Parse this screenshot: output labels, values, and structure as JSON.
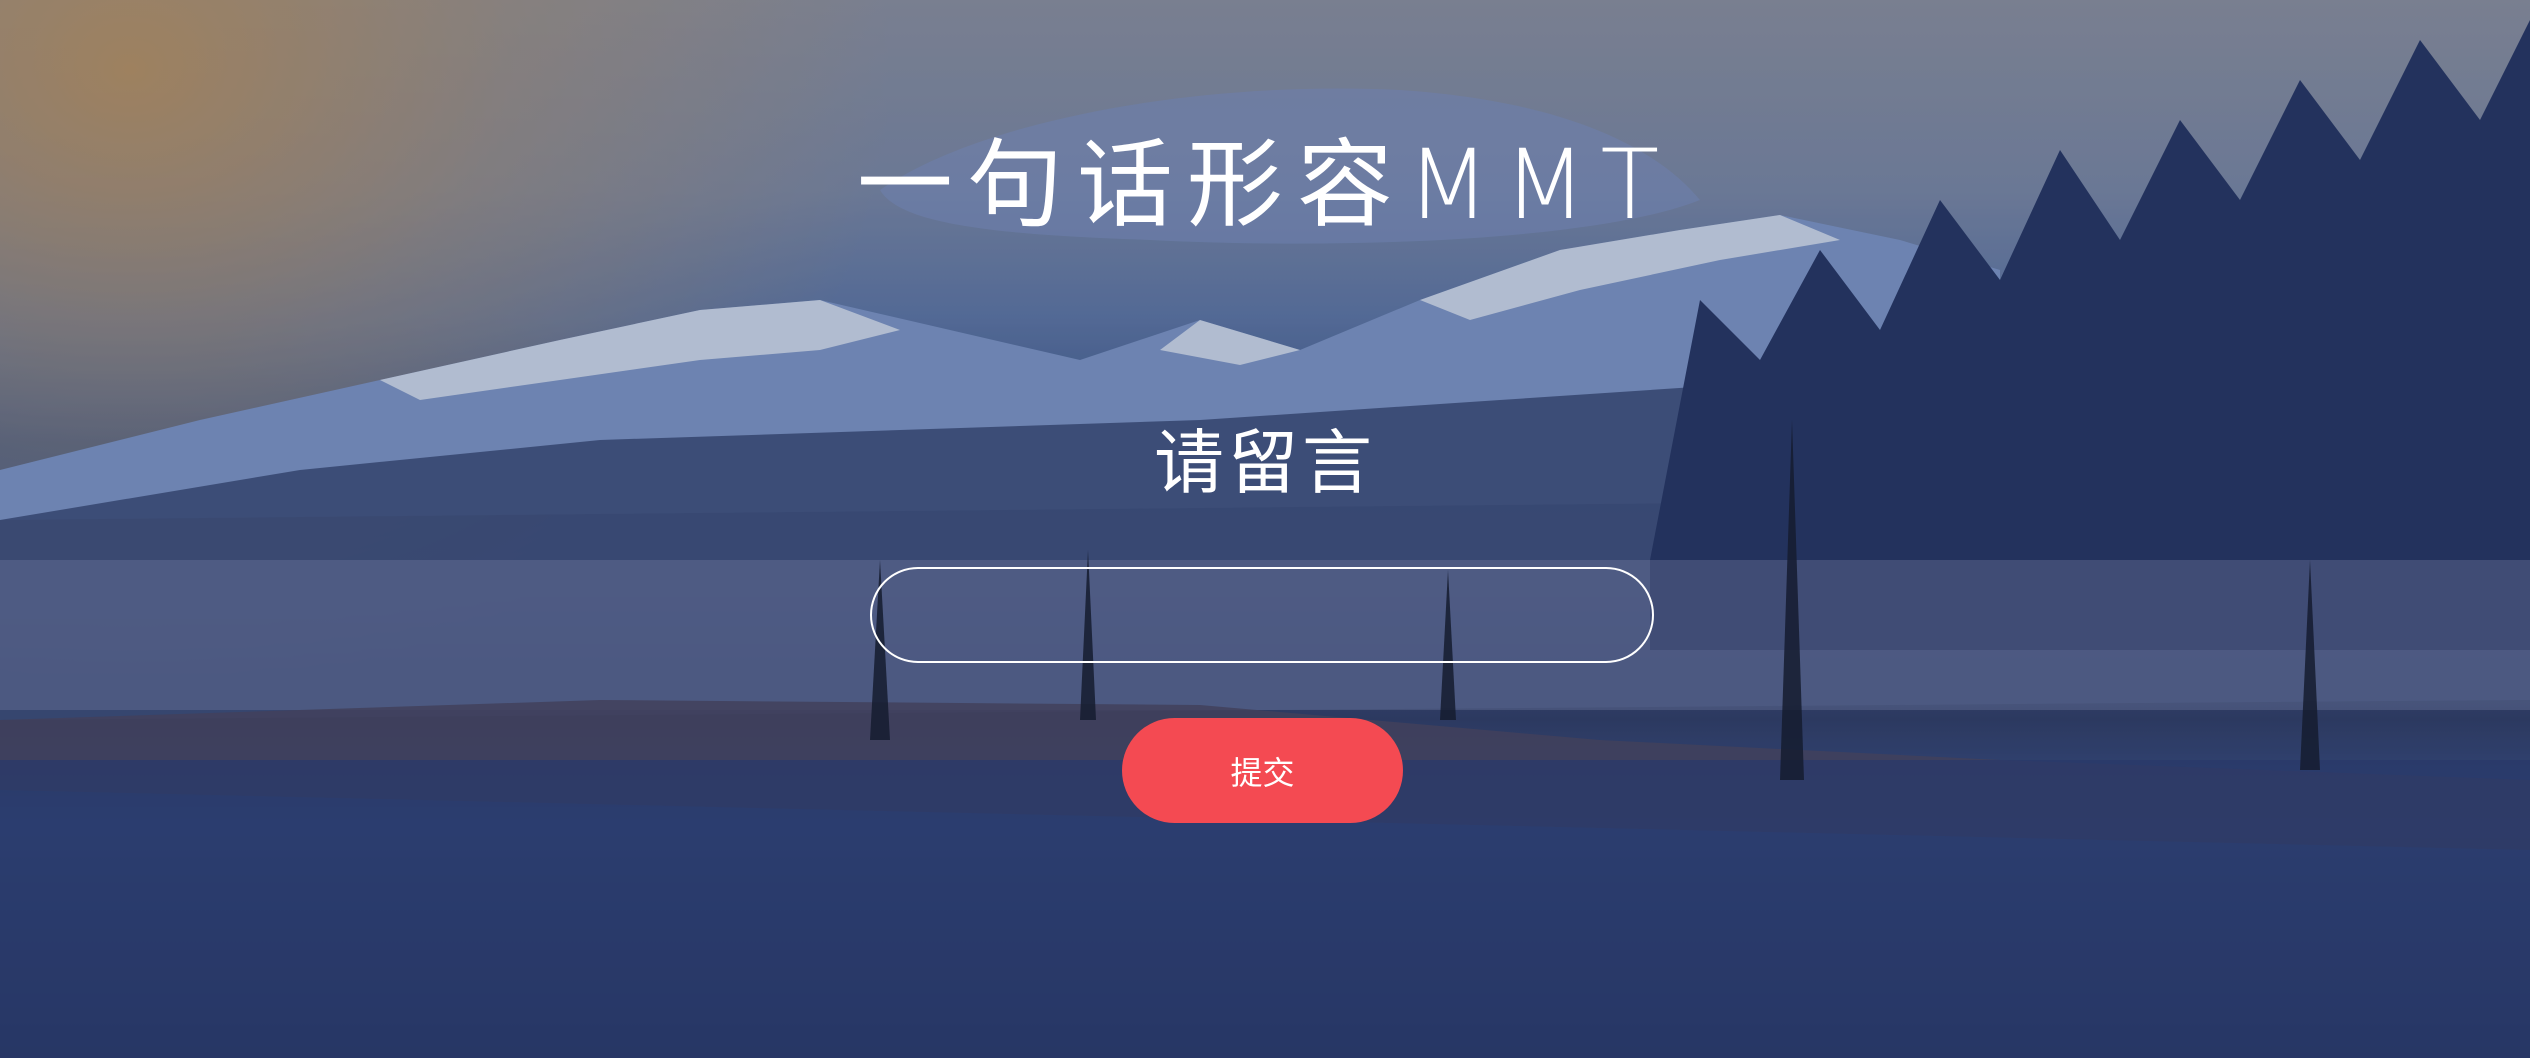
{
  "page": {
    "title": "一句话形容MMT",
    "prompt_label": "请留言"
  },
  "form": {
    "message_value": "",
    "submit_label": "提交"
  },
  "colors": {
    "accent": "#f44a52",
    "text": "#ffffff"
  },
  "background": {
    "description_icon": "mountain-lake-photo"
  }
}
